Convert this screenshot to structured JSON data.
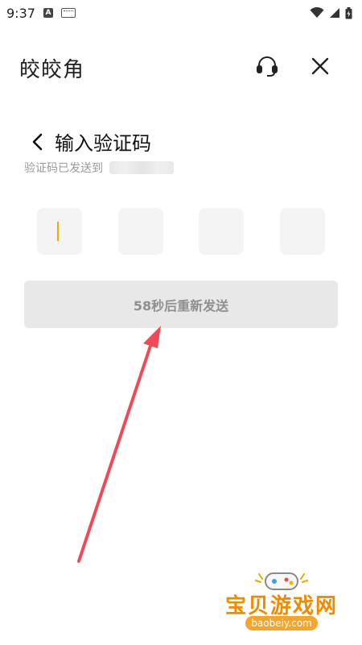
{
  "status_bar": {
    "time": "9:37",
    "notification_app_icon_letter": "A",
    "icons": [
      "android-icon",
      "keyboard-icon",
      "wifi-icon",
      "signal-icon",
      "battery-icon"
    ]
  },
  "header": {
    "brand": "皎皎角",
    "icons": [
      "headset-icon",
      "close-icon"
    ]
  },
  "page": {
    "title": "输入验证码",
    "subtitle": "验证码已发送到",
    "code_boxes": [
      "",
      "",
      "",
      ""
    ],
    "resend_button": "58秒后重新发送"
  },
  "annotation": {
    "color": "#ef4a55"
  },
  "watermark": {
    "title": "宝贝游戏网",
    "url": "baobeiy.com"
  },
  "colors": {
    "caret": "#f2a900",
    "button_bg": "#e8e8e8",
    "button_text": "#8f8f8f",
    "code_box_bg": "#f4f4f4"
  }
}
